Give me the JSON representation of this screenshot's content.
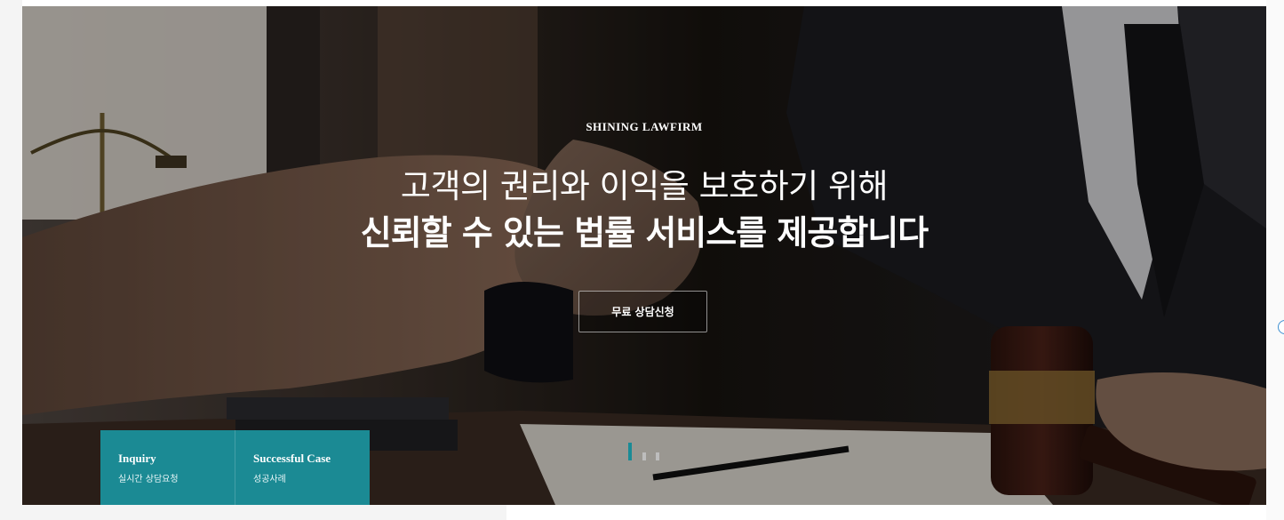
{
  "hero": {
    "eyebrow": "SHINING LAWFIRM",
    "headline_line1": "고객의 권리와 이익을 보호하기 위해",
    "headline_line2": "신뢰할 수 있는 법률 서비스를 제공합니다",
    "cta_label": "무료 상담신청",
    "slide_count": 3,
    "active_slide": 1
  },
  "quick_links": [
    {
      "title": "Inquiry",
      "subtitle": "실시간 상담요청"
    },
    {
      "title": "Successful Case",
      "subtitle": "성공사례"
    }
  ],
  "side_widget": {
    "icon": "chevron-left-icon",
    "glyph": "‹"
  },
  "colors": {
    "accent": "#1b8a94",
    "indicator_active": "#1a8b96",
    "indicator_inactive": "#bdbdbd",
    "text_on_dark": "#ffffff"
  }
}
